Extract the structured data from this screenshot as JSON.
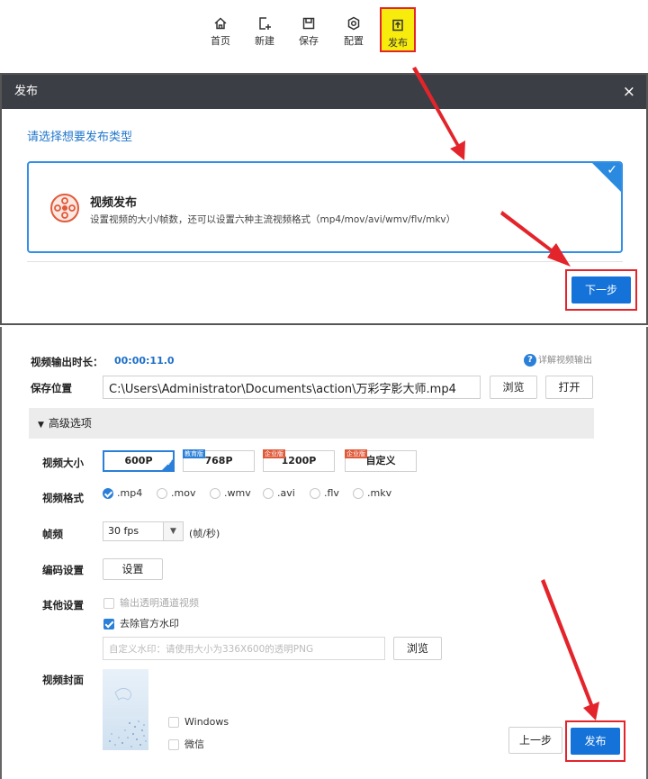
{
  "toolbar": {
    "items": [
      {
        "label": "首页",
        "icon": "home-icon"
      },
      {
        "label": "新建",
        "icon": "new-file-icon"
      },
      {
        "label": "保存",
        "icon": "save-icon"
      },
      {
        "label": "配置",
        "icon": "settings-icon"
      },
      {
        "label": "发布",
        "icon": "publish-icon",
        "active": true
      }
    ],
    "highlight_color": "#f7ec0b"
  },
  "dialog": {
    "title": "发布",
    "close": "×",
    "prompt": "请选择想要发布类型",
    "option": {
      "title": "视频发布",
      "description": "设置视频的大小/帧数，还可以设置六种主流视频格式（mp4/mov/avi/wmv/flv/mkv）",
      "selected": true
    },
    "next_button": "下一步"
  },
  "publish": {
    "duration_label": "视频输出时长：",
    "duration_value": "00:00:11.0",
    "help_link": "详解视频输出",
    "save_label": "保存位置",
    "save_path": "C:\\Users\\Administrator\\Documents\\action\\万彩字影大师.mp4",
    "browse_button": "浏览",
    "open_button": "打开",
    "advanced_label": "高级选项",
    "size_label": "视频大小",
    "sizes": [
      {
        "label": "600P",
        "tag": "",
        "selected": true
      },
      {
        "label": "768P",
        "tag": "教育版"
      },
      {
        "label": "1200P",
        "tag": "企业版"
      },
      {
        "label": "自定义",
        "tag": "企业版"
      }
    ],
    "format_label": "视频格式",
    "formats": [
      {
        "label": ".mp4",
        "selected": true
      },
      {
        "label": ".mov"
      },
      {
        "label": ".wmv"
      },
      {
        "label": ".avi"
      },
      {
        "label": ".flv"
      },
      {
        "label": ".mkv"
      }
    ],
    "fps_label": "帧频",
    "fps_value": "30 fps",
    "fps_unit": "(帧/秒)",
    "encode_label": "编码设置",
    "encode_button": "设置",
    "other_label": "其他设置",
    "transparent_option": "输出透明通道视频",
    "watermark_option": "去除官方水印",
    "watermark_placeholder": "自定义水印：请使用大小为336X600的透明PNG",
    "watermark_browse": "浏览",
    "cover_label": "视频封面",
    "cover_options": [
      "Windows",
      "微信"
    ],
    "prev_button": "上一步",
    "publish_button": "发布"
  },
  "colors": {
    "accent": "#1472d8",
    "annotation_red": "#e3242b",
    "dialog_header": "#3b3e44"
  }
}
